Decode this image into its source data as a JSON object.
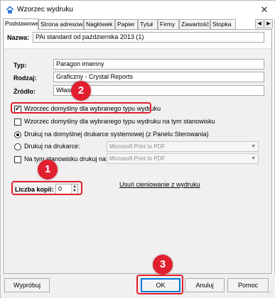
{
  "window": {
    "title": "Wzorzec wydruku",
    "close_symbol": "✕"
  },
  "tabs": [
    {
      "label": "Podstawowe",
      "active": true
    },
    {
      "label": "Strona adresowa"
    },
    {
      "label": "Nagłówek"
    },
    {
      "label": "Papier"
    },
    {
      "label": "Tytuł"
    },
    {
      "label": "Firmy"
    },
    {
      "label": "Zawartość"
    },
    {
      "label": "Stopka"
    }
  ],
  "tab_scroll": {
    "left": "◀",
    "right": "▶"
  },
  "form": {
    "name_label": "Nazwa:",
    "name_value": "PAi standard od października 2013 (1)",
    "type_label": "Typ:",
    "type_value": "Paragon imienny",
    "kind_label": "Rodzaj:",
    "kind_value": "Graficzny - Crystal Reports",
    "source_label": "Źródło:",
    "source_value": "Własny",
    "default_type_checkbox": "Wzorzec domyślny dla wybranego typu wydruku",
    "default_station_checkbox": "Wzorzec domyślny dla wybranego typu wydruku na tym stanowisku",
    "radio_default_printer": "Drukuj na domyślnej drukarce systemowej (z Panelu Sterowania)",
    "radio_printer": "Drukuj na drukarce:",
    "printer_combo_value": "Microsoft Print to PDF",
    "station_checkbox": "Na tym stanowisku drukuj na:",
    "station_combo_value": "Microsoft Print to PDF",
    "copies_label": "Liczba kopii:",
    "copies_value": "0",
    "remove_shading_link": "Usuń cieniowanie z wydruku"
  },
  "buttons": {
    "test": "Wypróbuj",
    "ok": "OK",
    "cancel": "Anuluj",
    "help": "Pomoc"
  },
  "annotations": {
    "badge1": "1",
    "badge2": "2",
    "badge3": "3",
    "color": "#e11f2e"
  }
}
